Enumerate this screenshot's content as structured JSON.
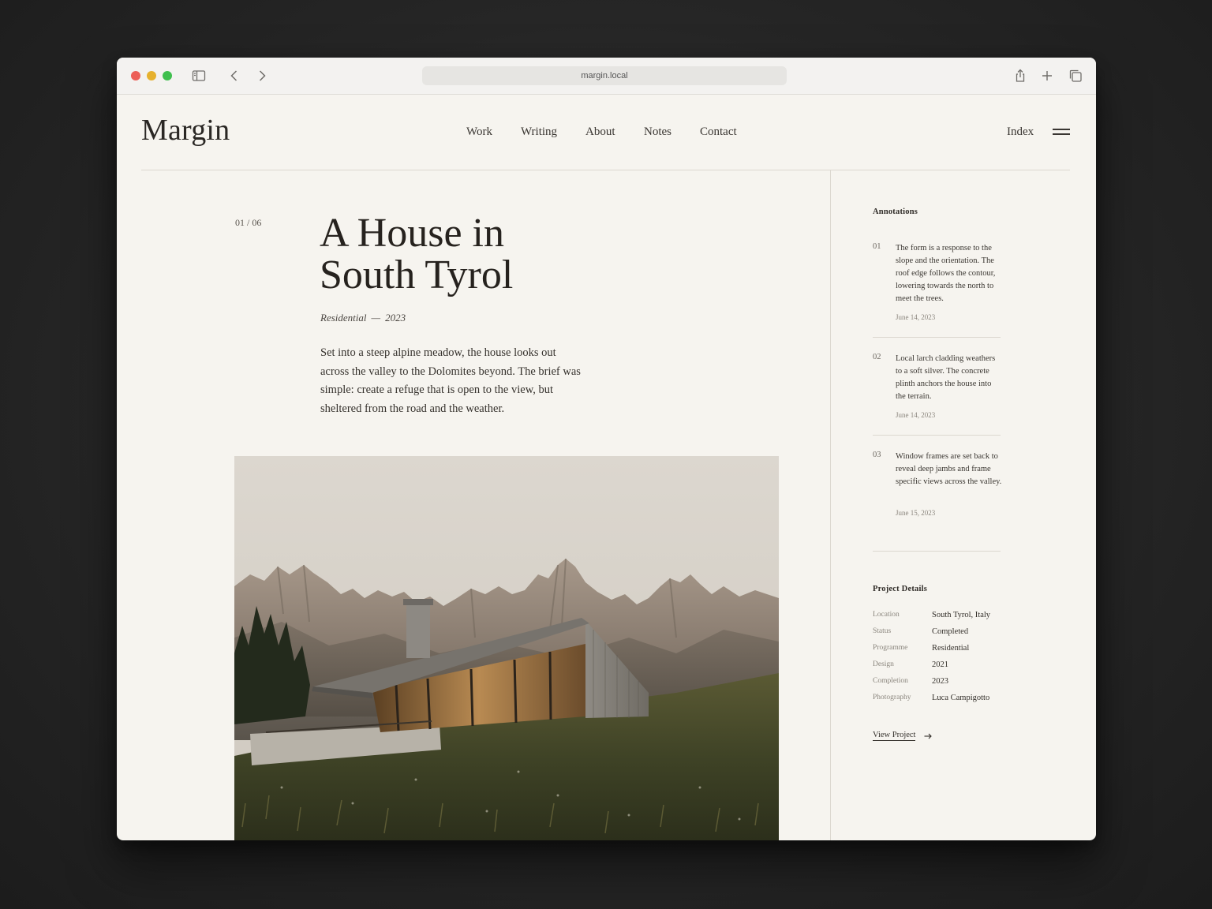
{
  "browser": {
    "url": "margin.local"
  },
  "site": {
    "logo": "Margin",
    "nav": [
      "Work",
      "Writing",
      "About",
      "Notes",
      "Contact"
    ],
    "index_label": "Index"
  },
  "article": {
    "counter": "01 / 06",
    "title_line1": "A House in",
    "title_line2": "South Tyrol",
    "category": "Residential",
    "dash": "—",
    "year": "2023",
    "lede": "Set into a steep alpine meadow, the house looks out across the valley to the Dolomites beyond. The brief was simple: create a refuge that is open to the view, but sheltered from the road and the weather."
  },
  "annotations": {
    "heading": "Annotations",
    "items": [
      {
        "num": "01",
        "text": "The form is a response to the slope and the orientation. The roof edge follows the contour, lowering towards the north to meet the trees.",
        "date": "June 14, 2023"
      },
      {
        "num": "02",
        "text": "Local larch cladding weathers to a soft silver. The concrete plinth anchors the house into the terrain.",
        "date": "June 14, 2023"
      },
      {
        "num": "03",
        "text": "Window frames are set back to reveal deep jambs and frame specific views across the valley.",
        "date": "June 15, 2023"
      }
    ]
  },
  "project_details": {
    "heading": "Project Details",
    "rows": [
      {
        "label": "Location",
        "value": "South Tyrol, Italy"
      },
      {
        "label": "Status",
        "value": "Completed"
      },
      {
        "label": "Programme",
        "value": "Residential"
      },
      {
        "label": "Design",
        "value": "2021"
      },
      {
        "label": "Completion",
        "value": "2023"
      },
      {
        "label": "Photography",
        "value": "Luca Campigotto"
      }
    ],
    "view_link": "View Project"
  },
  "colors": {
    "page_bg": "#f6f4ef",
    "text": "#26221e",
    "rule": "#dcd8d0"
  }
}
